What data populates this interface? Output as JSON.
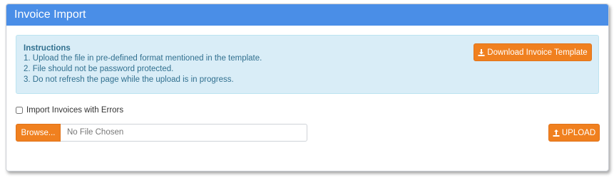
{
  "header": {
    "title": "Invoice Import"
  },
  "instructions": {
    "title": "Instructions",
    "lines": [
      "1. Upload the file in pre-defined format mentioned in the template.",
      "2. File should not be password protected.",
      "3. Do not refresh the page while the upload is in progress."
    ],
    "download_button_label": "Download Invoice Template",
    "download_icon": "download-icon"
  },
  "options": {
    "import_with_errors_label": "Import Invoices with Errors",
    "import_with_errors_checked": false
  },
  "file_upload": {
    "browse_label": "Browse...",
    "file_placeholder": "No File Chosen",
    "upload_label": "UPLOAD",
    "upload_icon": "upload-icon"
  },
  "colors": {
    "header_bg": "#4a8ee7",
    "accent_orange": "#f0801f",
    "info_bg": "#d9edf7",
    "info_text": "#31708f"
  }
}
